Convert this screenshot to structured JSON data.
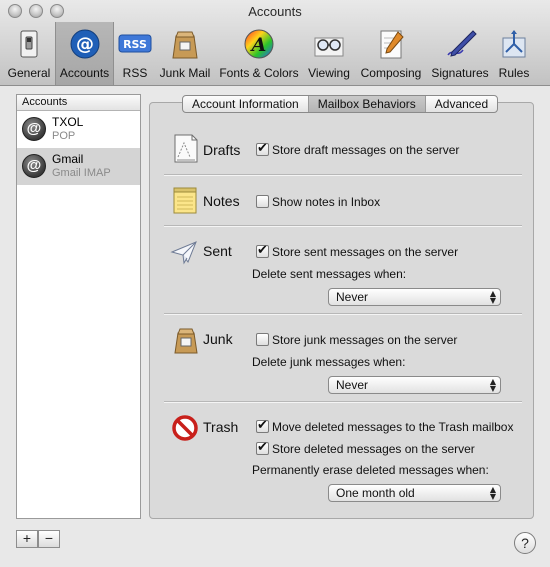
{
  "window": {
    "title": "Accounts"
  },
  "toolbar": {
    "items": [
      {
        "label": "General",
        "icon": "general-switch-icon"
      },
      {
        "label": "Accounts",
        "icon": "at-sign-icon"
      },
      {
        "label": "RSS",
        "icon": "rss-icon"
      },
      {
        "label": "Junk Mail",
        "icon": "junk-mail-bag-icon"
      },
      {
        "label": "Fonts & Colors",
        "icon": "fonts-colors-icon"
      },
      {
        "label": "Viewing",
        "icon": "glasses-icon"
      },
      {
        "label": "Composing",
        "icon": "composing-pen-icon"
      },
      {
        "label": "Signatures",
        "icon": "signature-pen-icon"
      },
      {
        "label": "Rules",
        "icon": "rules-icon"
      }
    ],
    "selected": "Accounts",
    "rss_badge": "RSS"
  },
  "accounts": {
    "header": "Accounts",
    "items": [
      {
        "name": "TXOL",
        "type": "POP"
      },
      {
        "name": "Gmail",
        "type": "Gmail IMAP"
      }
    ],
    "selected": "Gmail",
    "add_label": "+",
    "remove_label": "−"
  },
  "tabs": {
    "items": [
      "Account Information",
      "Mailbox Behaviors",
      "Advanced"
    ],
    "active": "Mailbox Behaviors"
  },
  "sections": {
    "drafts": {
      "title": "Drafts",
      "store_label": "Store draft messages on the server",
      "store_checked": true
    },
    "notes": {
      "title": "Notes",
      "show_label": "Show notes in Inbox",
      "show_checked": false
    },
    "sent": {
      "title": "Sent",
      "store_label": "Store sent messages on the server",
      "store_checked": true,
      "delete_label": "Delete sent messages when:",
      "delete_value": "Never"
    },
    "junk": {
      "title": "Junk",
      "store_label": "Store junk messages on the server",
      "store_checked": false,
      "delete_label": "Delete junk messages when:",
      "delete_value": "Never"
    },
    "trash": {
      "title": "Trash",
      "move_label": "Move deleted messages to the Trash mailbox",
      "move_checked": true,
      "store_label": "Store deleted messages on the server",
      "store_checked": true,
      "erase_label": "Permanently erase deleted messages when:",
      "erase_value": "One month old"
    }
  },
  "help": {
    "label": "?"
  },
  "colors": {
    "accent_blue": "#1f5fb7",
    "selection_gray": "#d4d4d4",
    "trash_red": "#c8201b"
  }
}
